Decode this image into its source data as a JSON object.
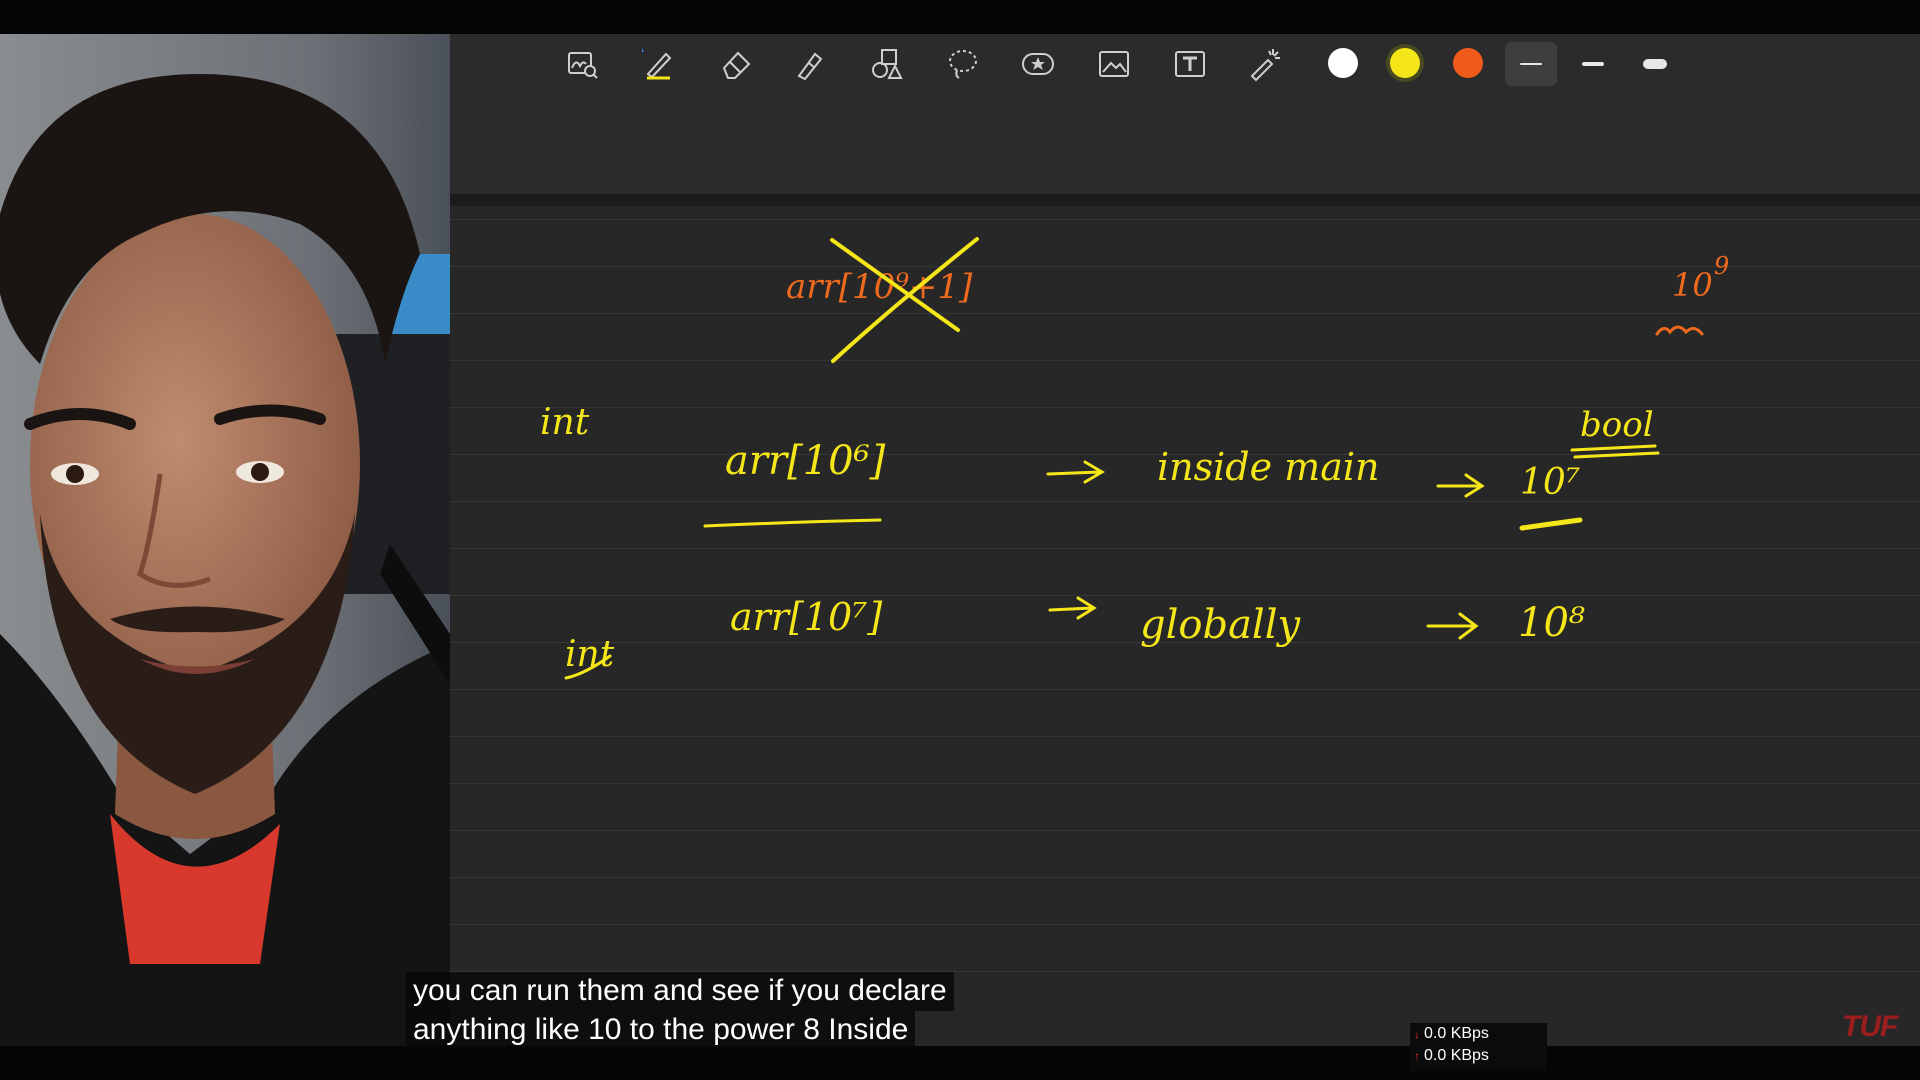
{
  "caption": {
    "line1": "you can run them and see if you declare",
    "line2": "anything like 10 to the power 8 Inside"
  },
  "network": {
    "download": "0.0 KBps",
    "upload": "0.0 KBps"
  },
  "logo": "TUF",
  "toolbar": {
    "tools": [
      "zoom-icon",
      "pen-icon",
      "eraser-icon",
      "highlighter-icon",
      "shapes-icon",
      "lasso-icon",
      "sticker-icon",
      "image-icon",
      "text-icon",
      "laser-pointer-icon"
    ],
    "selected_tool": "pen-icon",
    "colors": [
      "#ffffff",
      "#f5e61a",
      "#f05a1a"
    ],
    "selected_color": "#f5e61a",
    "stroke_sizes": [
      "thin",
      "medium",
      "thick"
    ],
    "selected_stroke": "thin"
  },
  "notes": {
    "crossed": "arr[10^9+1]",
    "top_right": "10^9",
    "row1_type": "int",
    "row1_decl": "arr[10^6]",
    "row1_scope": "inside main",
    "row1_limit": "10^7",
    "row1_bool": "bool",
    "row2_type": "int",
    "row2_decl": "arr[10^7]",
    "row2_scope": "globally",
    "row2_limit": "10^8"
  }
}
